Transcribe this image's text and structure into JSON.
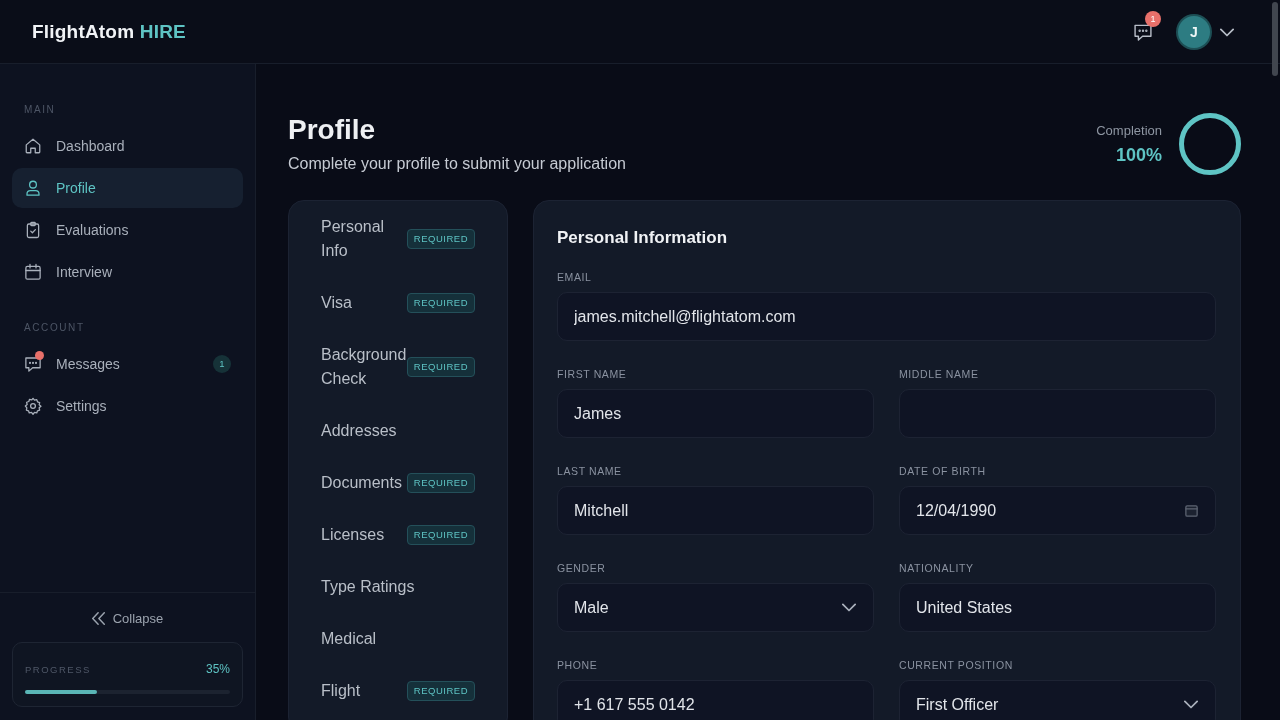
{
  "header": {
    "logo": {
      "name": "FlightAtom",
      "product": "HIRE"
    },
    "notifications": {
      "count": "1"
    },
    "user": {
      "initial": "J"
    }
  },
  "sidebar": {
    "sections": [
      {
        "title": "MAIN",
        "items": [
          {
            "label": "Dashboard",
            "selected": false,
            "unread": false
          },
          {
            "label": "Profile",
            "selected": true,
            "unread": false
          },
          {
            "label": "Evaluations",
            "selected": false,
            "unread": false
          },
          {
            "label": "Interview",
            "selected": false,
            "unread": false
          }
        ]
      },
      {
        "title": "ACCOUNT",
        "items": [
          {
            "label": "Messages",
            "selected": false,
            "unread": true,
            "count": "1"
          },
          {
            "label": "Settings",
            "selected": false,
            "unread": false
          }
        ]
      }
    ],
    "collapse": {
      "label": "Collapse"
    },
    "progress": {
      "label": "PROGRESS",
      "reading": "35%",
      "level": 0.35
    }
  },
  "page": {
    "title": "Profile",
    "subtitle": "Complete your profile to submit your application",
    "completion": {
      "label": "Completion",
      "reading": "100%",
      "level": 1
    }
  },
  "sections_nav": {
    "items": [
      {
        "label": "Personal Info",
        "badge": "REQUIRED"
      },
      {
        "label": "Visa",
        "badge": "REQUIRED"
      },
      {
        "label": "Background Check",
        "badge": "REQUIRED"
      },
      {
        "label": "Addresses"
      },
      {
        "label": "Documents",
        "badge": "REQUIRED"
      },
      {
        "label": "Licenses",
        "badge": "REQUIRED"
      },
      {
        "label": "Type Ratings"
      },
      {
        "label": "Medical"
      },
      {
        "label": "Flight",
        "badge": "REQUIRED"
      }
    ]
  },
  "form": {
    "title": "Personal Information",
    "rows": [
      [
        {
          "label": "EMAIL",
          "kind": "text",
          "value": "james.mitchell@flightatom.com"
        }
      ],
      [
        {
          "label": "FIRST NAME",
          "kind": "text",
          "value": "James"
        },
        {
          "label": "MIDDLE NAME",
          "kind": "text"
        }
      ],
      [
        {
          "label": "LAST NAME",
          "kind": "text",
          "value": "Mitchell"
        },
        {
          "label": "DATE OF BIRTH",
          "kind": "date",
          "value": "12/04/1990"
        }
      ],
      [
        {
          "label": "GENDER",
          "kind": "select",
          "value": "Male"
        },
        {
          "label": "NATIONALITY",
          "kind": "text",
          "value": "United States"
        }
      ],
      [
        {
          "label": "PHONE",
          "kind": "text",
          "value": "+1 617 555 0142"
        },
        {
          "label": "CURRENT POSITION",
          "kind": "select",
          "value": "First Officer"
        }
      ]
    ]
  }
}
